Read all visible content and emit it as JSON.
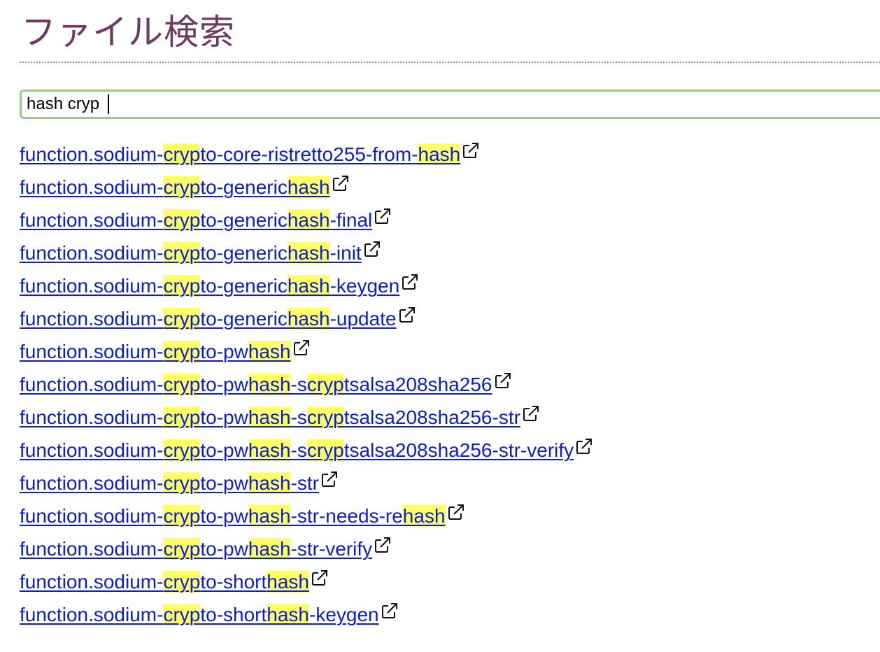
{
  "page": {
    "title": "ファイル検索"
  },
  "search": {
    "value": "hash cryp "
  },
  "colors": {
    "title": "#6e3a63",
    "link": "#0b1cd6",
    "highlight": "#ffff66",
    "search_border": "#9cc98a"
  },
  "results": [
    [
      [
        "function.sodium-",
        false
      ],
      [
        "cryp",
        true
      ],
      [
        "to-core-ristretto255-from-",
        false
      ],
      [
        "hash",
        true
      ]
    ],
    [
      [
        "function.sodium-",
        false
      ],
      [
        "cryp",
        true
      ],
      [
        "to-generic",
        false
      ],
      [
        "hash",
        true
      ]
    ],
    [
      [
        "function.sodium-",
        false
      ],
      [
        "cryp",
        true
      ],
      [
        "to-generic",
        false
      ],
      [
        "hash",
        true
      ],
      [
        "-final",
        false
      ]
    ],
    [
      [
        "function.sodium-",
        false
      ],
      [
        "cryp",
        true
      ],
      [
        "to-generic",
        false
      ],
      [
        "hash",
        true
      ],
      [
        "-init",
        false
      ]
    ],
    [
      [
        "function.sodium-",
        false
      ],
      [
        "cryp",
        true
      ],
      [
        "to-generic",
        false
      ],
      [
        "hash",
        true
      ],
      [
        "-keygen",
        false
      ]
    ],
    [
      [
        "function.sodium-",
        false
      ],
      [
        "cryp",
        true
      ],
      [
        "to-generic",
        false
      ],
      [
        "hash",
        true
      ],
      [
        "-update",
        false
      ]
    ],
    [
      [
        "function.sodium-",
        false
      ],
      [
        "cryp",
        true
      ],
      [
        "to-pw",
        false
      ],
      [
        "hash",
        true
      ]
    ],
    [
      [
        "function.sodium-",
        false
      ],
      [
        "cryp",
        true
      ],
      [
        "to-pw",
        false
      ],
      [
        "hash",
        true
      ],
      [
        "-s",
        false
      ],
      [
        "cryp",
        true
      ],
      [
        "tsalsa208sha256",
        false
      ]
    ],
    [
      [
        "function.sodium-",
        false
      ],
      [
        "cryp",
        true
      ],
      [
        "to-pw",
        false
      ],
      [
        "hash",
        true
      ],
      [
        "-s",
        false
      ],
      [
        "cryp",
        true
      ],
      [
        "tsalsa208sha256-str",
        false
      ]
    ],
    [
      [
        "function.sodium-",
        false
      ],
      [
        "cryp",
        true
      ],
      [
        "to-pw",
        false
      ],
      [
        "hash",
        true
      ],
      [
        "-s",
        false
      ],
      [
        "cryp",
        true
      ],
      [
        "tsalsa208sha256-str-verify",
        false
      ]
    ],
    [
      [
        "function.sodium-",
        false
      ],
      [
        "cryp",
        true
      ],
      [
        "to-pw",
        false
      ],
      [
        "hash",
        true
      ],
      [
        "-str",
        false
      ]
    ],
    [
      [
        "function.sodium-",
        false
      ],
      [
        "cryp",
        true
      ],
      [
        "to-pw",
        false
      ],
      [
        "hash",
        true
      ],
      [
        "-str-needs-re",
        false
      ],
      [
        "hash",
        true
      ]
    ],
    [
      [
        "function.sodium-",
        false
      ],
      [
        "cryp",
        true
      ],
      [
        "to-pw",
        false
      ],
      [
        "hash",
        true
      ],
      [
        "-str-verify",
        false
      ]
    ],
    [
      [
        "function.sodium-",
        false
      ],
      [
        "cryp",
        true
      ],
      [
        "to-short",
        false
      ],
      [
        "hash",
        true
      ]
    ],
    [
      [
        "function.sodium-",
        false
      ],
      [
        "cryp",
        true
      ],
      [
        "to-short",
        false
      ],
      [
        "hash",
        true
      ],
      [
        "-keygen",
        false
      ]
    ]
  ],
  "icons": {
    "result_link": "external-link-icon"
  }
}
